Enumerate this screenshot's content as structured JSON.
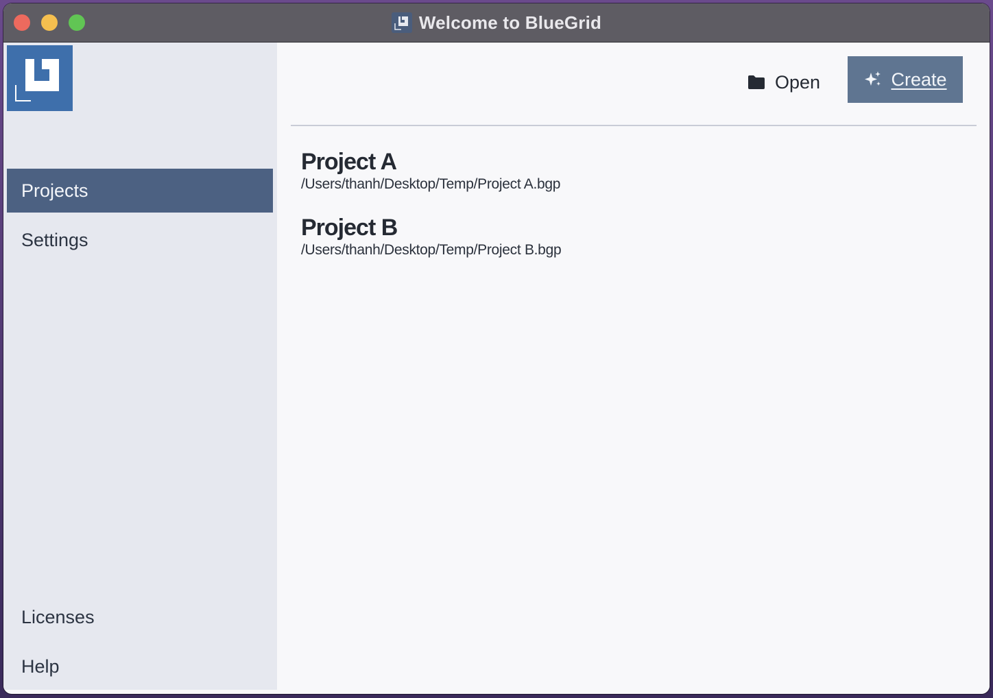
{
  "window": {
    "title": "Welcome to BlueGrid"
  },
  "sidebar": {
    "logo": "bluegrid-logo",
    "items": [
      {
        "label": "Projects",
        "active": true
      },
      {
        "label": "Settings",
        "active": false
      }
    ],
    "bottom_items": [
      {
        "label": "Licenses"
      },
      {
        "label": "Help"
      }
    ]
  },
  "toolbar": {
    "open_label": "Open",
    "open_icon": "folder-icon",
    "create_label": "Create",
    "create_icon": "sparkle-icon"
  },
  "projects": [
    {
      "name": "Project A",
      "path": "/Users/thanh/Desktop/Temp/Project A.bgp"
    },
    {
      "name": "Project B",
      "path": "/Users/thanh/Desktop/Temp/Project B.bgp"
    }
  ],
  "colors": {
    "accent": "#4c6182",
    "create_button": "#5f7591",
    "logo": "#3e6fab",
    "sidebar_bg": "#e6e8ef",
    "titlebar": "#5e5c63"
  }
}
